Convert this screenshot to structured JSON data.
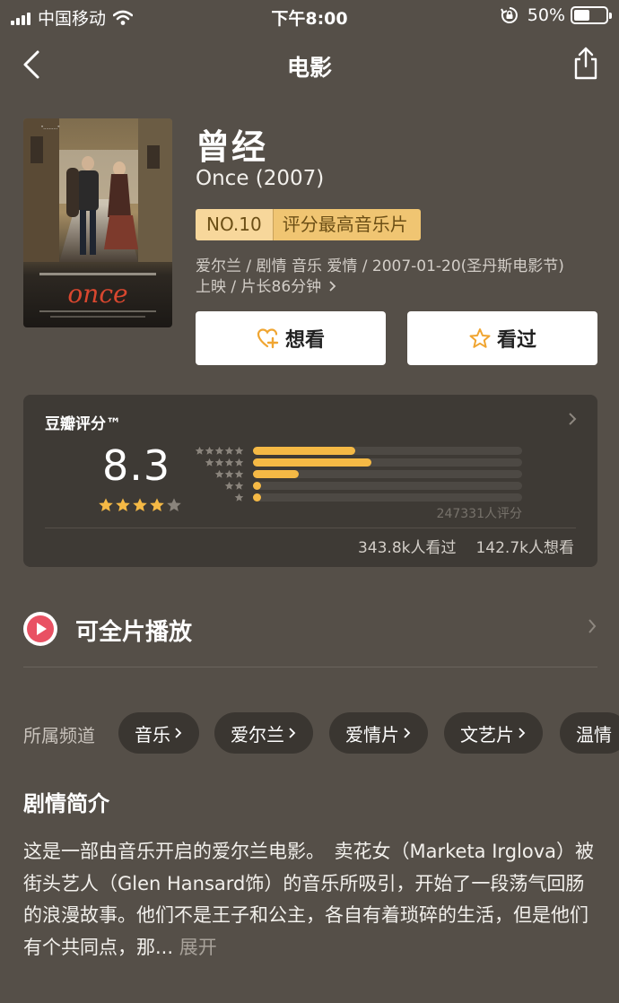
{
  "status_bar": {
    "carrier": "中国移动",
    "time": "下午8:00",
    "battery": "50%",
    "battery_level": 0.5
  },
  "nav": {
    "title": "电影",
    "back_icon": "chevron-left-icon",
    "share_icon": "share-icon"
  },
  "movie": {
    "title": "曾经",
    "subtitle": "Once (2007)",
    "rank_no": "NO.10",
    "rank_desc": "评分最高音乐片",
    "meta_line1": "爱尔兰 / 剧情 音乐 爱情 / 2007-01-20(圣丹斯电影节)",
    "meta_line2": "上映 / 片长86分钟",
    "poster_word": "once",
    "want_label": "想看",
    "seen_label": "看过"
  },
  "rating": {
    "label": "豆瓣评分™",
    "score": "8.3",
    "stars": 4,
    "distribution": [
      {
        "stars": 5,
        "fraction": 0.38
      },
      {
        "stars": 4,
        "fraction": 0.44
      },
      {
        "stars": 3,
        "fraction": 0.17
      },
      {
        "stars": 2,
        "fraction": 0.03
      },
      {
        "stars": 1,
        "fraction": 0.03
      }
    ],
    "count": "247331人评分",
    "seen": "343.8k人看过",
    "want": "142.7k人想看",
    "accent": "#f5b945"
  },
  "play": {
    "label": "可全片播放",
    "icon": "play-icon"
  },
  "channels": {
    "label": "所属频道",
    "items": [
      "音乐",
      "爱尔兰",
      "爱情片",
      "文艺片",
      "温情"
    ]
  },
  "synopsis": {
    "title": "剧情简介",
    "text": "这是一部由音乐开启的爱尔兰电影。　卖花女（Marketa Irglova）被街头艺人（Glen Hansard饰）的音乐所吸引，开始了一段荡气回肠的浪漫故事。他们不是王子和公主，各自有着琐碎的生活，但是他们有个共同点，那...",
    "more": "展开"
  }
}
